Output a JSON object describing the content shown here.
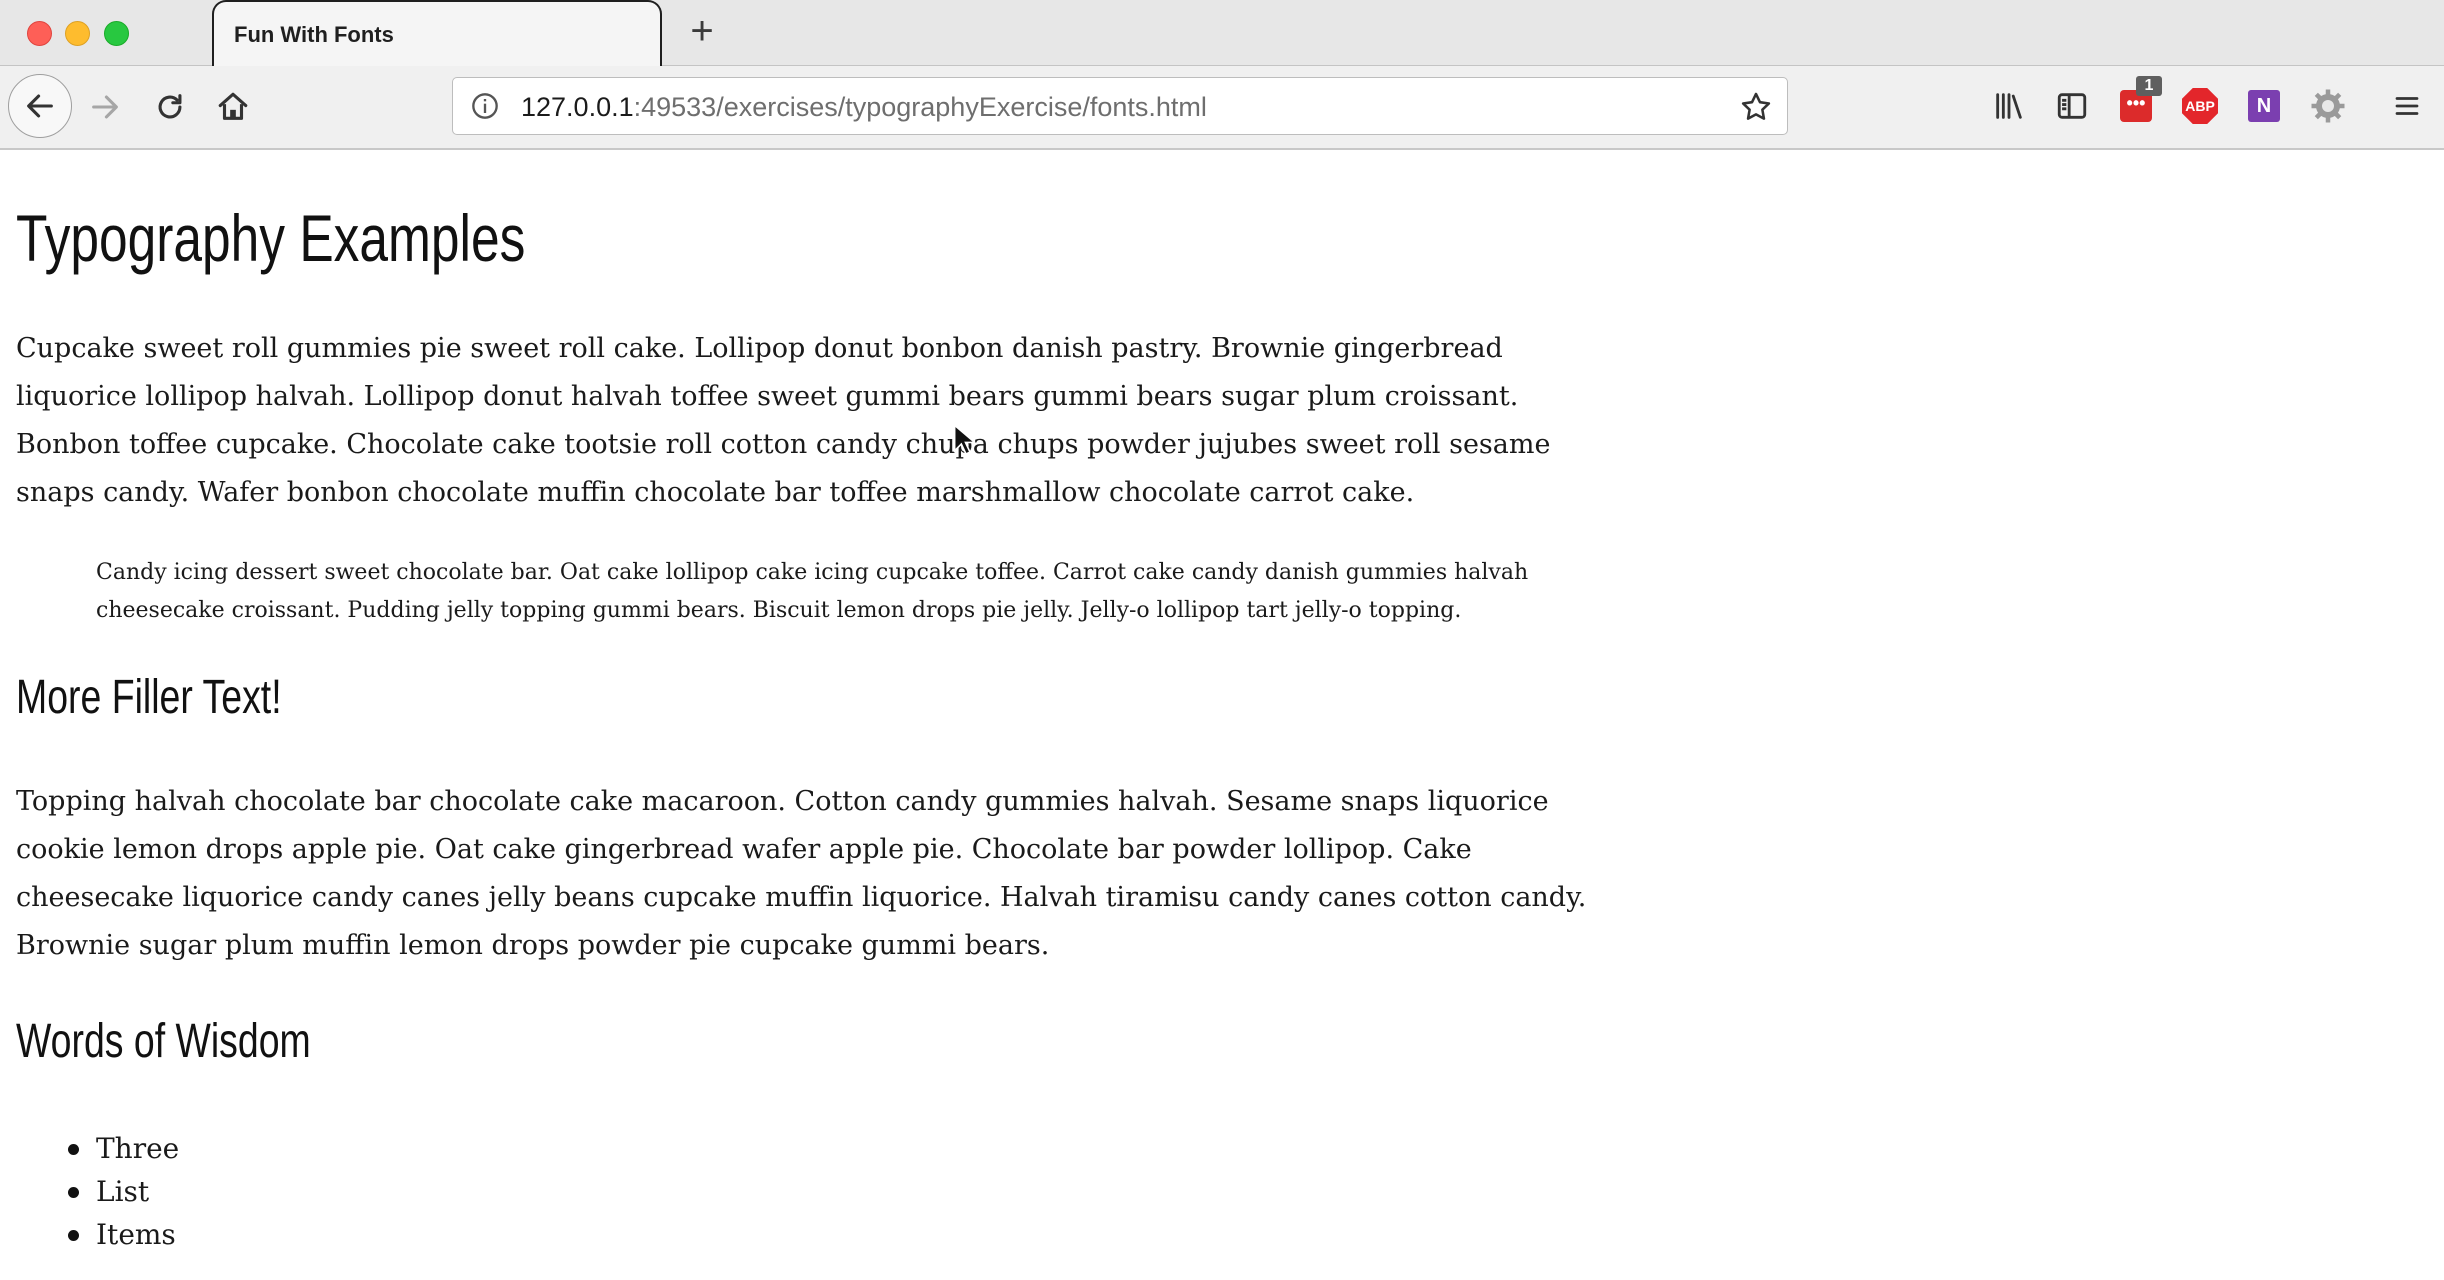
{
  "browser": {
    "tab_title": "Fun With Fonts",
    "new_tab_label": "+",
    "url_host": "127.0.0.1",
    "url_rest": ":49533/exercises/typographyExercise/fonts.html",
    "extension_badge": "1",
    "abp_label": "ABP",
    "onenote_label": "N"
  },
  "content": {
    "title": "Typography Examples",
    "paragraph1": "Cupcake sweet roll gummies pie sweet roll cake. Lollipop donut bonbon danish pastry. Brownie gingerbread liquorice lollipop halvah. Lollipop donut halvah toffee sweet gummi bears gummi bears sugar plum croissant. Bonbon toffee cupcake. Chocolate cake tootsie roll cotton candy chupa chups powder jujubes sweet roll sesame snaps candy. Wafer bonbon chocolate muffin chocolate bar toffee marshmallow chocolate carrot cake.",
    "blockquote": "Candy icing dessert sweet chocolate bar. Oat cake lollipop cake icing cupcake toffee. Carrot cake candy danish gummies halvah cheesecake croissant. Pudding jelly topping gummi bears. Biscuit lemon drops pie jelly. Jelly-o lollipop tart jelly-o topping.",
    "heading2": "More Filler Text!",
    "paragraph2": "Topping halvah chocolate bar chocolate cake macaroon. Cotton candy gummies halvah. Sesame snaps liquorice cookie lemon drops apple pie. Oat cake gingerbread wafer apple pie. Chocolate bar powder lollipop. Cake cheesecake liquorice candy canes jelly beans cupcake muffin liquorice. Halvah tiramisu candy canes cotton candy. Brownie sugar plum muffin lemon drops powder pie cupcake gummi bears.",
    "heading3": "Words of Wisdom",
    "list": [
      "Three",
      "List",
      "Items"
    ]
  }
}
